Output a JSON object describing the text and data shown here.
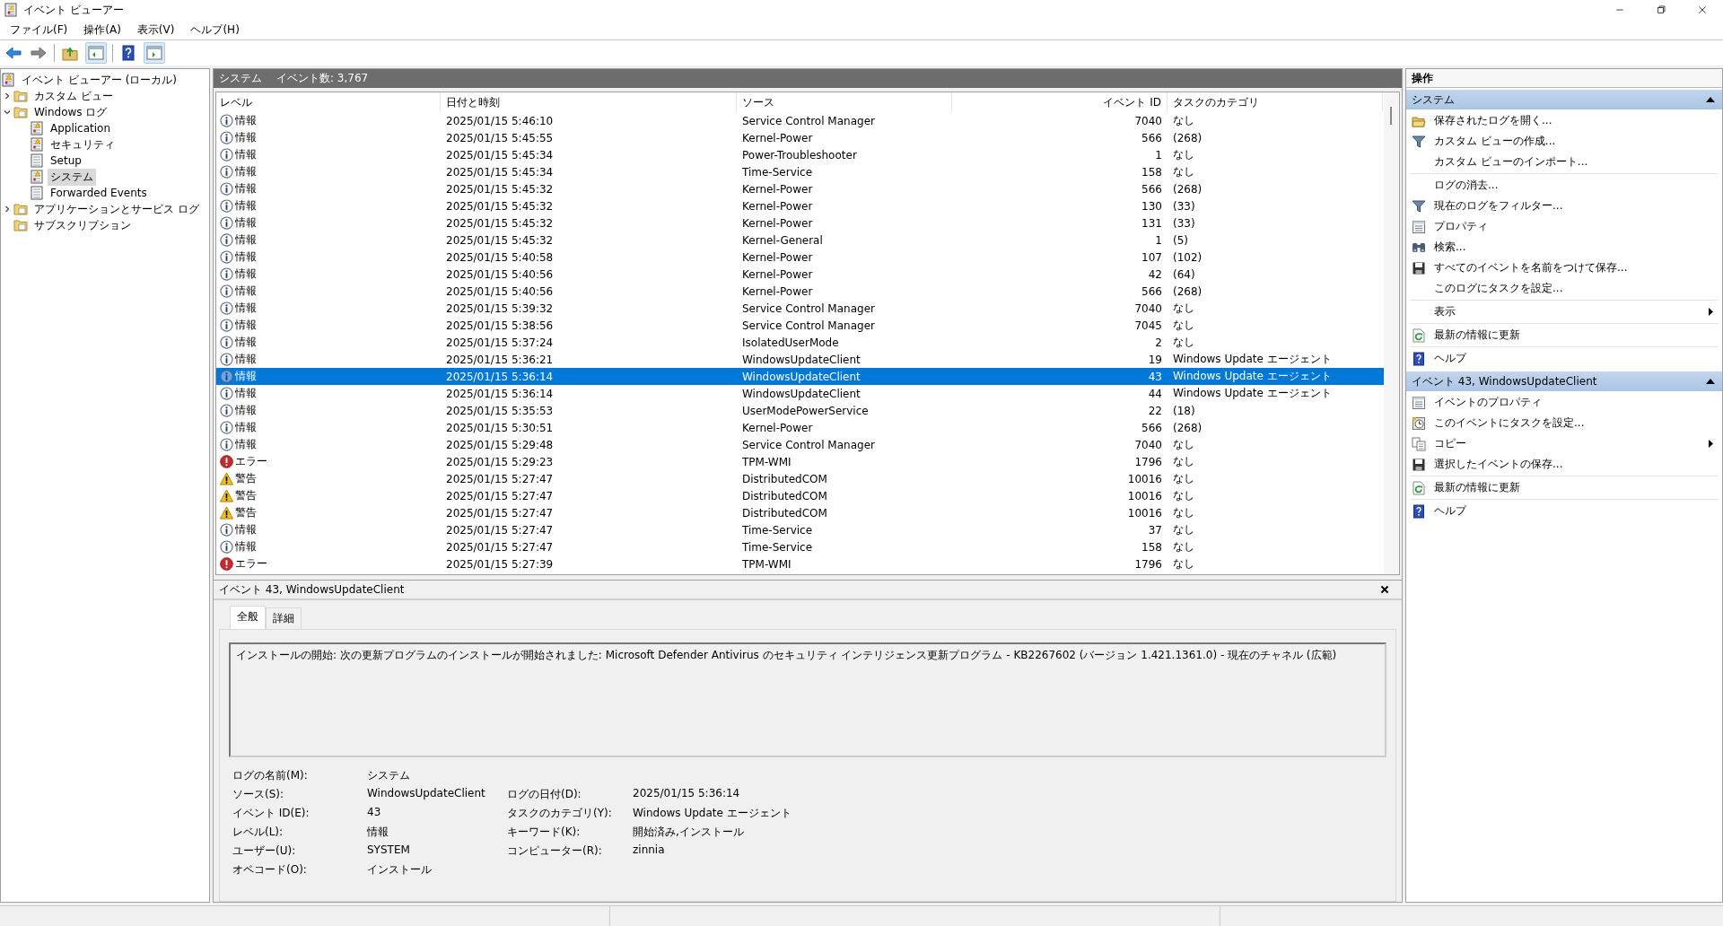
{
  "window": {
    "title": "イベント ビューアー"
  },
  "menu": [
    "ファイル(F)",
    "操作(A)",
    "表示(V)",
    "ヘルプ(H)"
  ],
  "tree": [
    {
      "label": "イベント ビューアー (ローカル)",
      "kind": "viewer",
      "selected": false,
      "children": [
        {
          "label": "カスタム ビュー",
          "kind": "folder",
          "expanded": false,
          "selected": false
        },
        {
          "label": "Windows ログ",
          "kind": "folder",
          "expanded": true,
          "selected": false,
          "children": [
            {
              "label": "Application",
              "kind": "log",
              "selected": false
            },
            {
              "label": "セキュリティ",
              "kind": "log",
              "selected": false
            },
            {
              "label": "Setup",
              "kind": "plain-log",
              "selected": false
            },
            {
              "label": "システム",
              "kind": "log",
              "selected": true
            },
            {
              "label": "Forwarded Events",
              "kind": "plain-log",
              "selected": false
            }
          ]
        },
        {
          "label": "アプリケーションとサービス ログ",
          "kind": "folder",
          "expanded": false,
          "selected": false
        },
        {
          "label": "サブスクリプション",
          "kind": "folder",
          "selected": false
        }
      ]
    }
  ],
  "log_header": {
    "title": "システム",
    "count": "イベント数: 3,767"
  },
  "table": {
    "columns": [
      "レベル",
      "日付と時刻",
      "ソース",
      "イベント ID",
      "タスクのカテゴリ"
    ],
    "rows": [
      {
        "kind": "info",
        "level": "情報",
        "date": "2025/01/15 5:46:10",
        "source": "Service Control Manager",
        "id": "7040",
        "category": "なし",
        "selected": false
      },
      {
        "kind": "info",
        "level": "情報",
        "date": "2025/01/15 5:45:55",
        "source": "Kernel-Power",
        "id": "566",
        "category": "(268)",
        "selected": false
      },
      {
        "kind": "info",
        "level": "情報",
        "date": "2025/01/15 5:45:34",
        "source": "Power-Troubleshooter",
        "id": "1",
        "category": "なし",
        "selected": false
      },
      {
        "kind": "info",
        "level": "情報",
        "date": "2025/01/15 5:45:34",
        "source": "Time-Service",
        "id": "158",
        "category": "なし",
        "selected": false
      },
      {
        "kind": "info",
        "level": "情報",
        "date": "2025/01/15 5:45:32",
        "source": "Kernel-Power",
        "id": "566",
        "category": "(268)",
        "selected": false
      },
      {
        "kind": "info",
        "level": "情報",
        "date": "2025/01/15 5:45:32",
        "source": "Kernel-Power",
        "id": "130",
        "category": "(33)",
        "selected": false
      },
      {
        "kind": "info",
        "level": "情報",
        "date": "2025/01/15 5:45:32",
        "source": "Kernel-Power",
        "id": "131",
        "category": "(33)",
        "selected": false
      },
      {
        "kind": "info",
        "level": "情報",
        "date": "2025/01/15 5:45:32",
        "source": "Kernel-General",
        "id": "1",
        "category": "(5)",
        "selected": false
      },
      {
        "kind": "info",
        "level": "情報",
        "date": "2025/01/15 5:40:58",
        "source": "Kernel-Power",
        "id": "107",
        "category": "(102)",
        "selected": false
      },
      {
        "kind": "info",
        "level": "情報",
        "date": "2025/01/15 5:40:56",
        "source": "Kernel-Power",
        "id": "42",
        "category": "(64)",
        "selected": false
      },
      {
        "kind": "info",
        "level": "情報",
        "date": "2025/01/15 5:40:56",
        "source": "Kernel-Power",
        "id": "566",
        "category": "(268)",
        "selected": false
      },
      {
        "kind": "info",
        "level": "情報",
        "date": "2025/01/15 5:39:32",
        "source": "Service Control Manager",
        "id": "7040",
        "category": "なし",
        "selected": false
      },
      {
        "kind": "info",
        "level": "情報",
        "date": "2025/01/15 5:38:56",
        "source": "Service Control Manager",
        "id": "7045",
        "category": "なし",
        "selected": false
      },
      {
        "kind": "info",
        "level": "情報",
        "date": "2025/01/15 5:37:24",
        "source": "IsolatedUserMode",
        "id": "2",
        "category": "なし",
        "selected": false
      },
      {
        "kind": "info",
        "level": "情報",
        "date": "2025/01/15 5:36:21",
        "source": "WindowsUpdateClient",
        "id": "19",
        "category": "Windows Update エージェント",
        "selected": false
      },
      {
        "kind": "info",
        "level": "情報",
        "date": "2025/01/15 5:36:14",
        "source": "WindowsUpdateClient",
        "id": "43",
        "category": "Windows Update エージェント",
        "selected": true
      },
      {
        "kind": "info",
        "level": "情報",
        "date": "2025/01/15 5:36:14",
        "source": "WindowsUpdateClient",
        "id": "44",
        "category": "Windows Update エージェント",
        "selected": false
      },
      {
        "kind": "info",
        "level": "情報",
        "date": "2025/01/15 5:35:53",
        "source": "UserModePowerService",
        "id": "22",
        "category": "(18)",
        "selected": false
      },
      {
        "kind": "info",
        "level": "情報",
        "date": "2025/01/15 5:30:51",
        "source": "Kernel-Power",
        "id": "566",
        "category": "(268)",
        "selected": false
      },
      {
        "kind": "info",
        "level": "情報",
        "date": "2025/01/15 5:29:48",
        "source": "Service Control Manager",
        "id": "7040",
        "category": "なし",
        "selected": false
      },
      {
        "kind": "error",
        "level": "エラー",
        "date": "2025/01/15 5:29:23",
        "source": "TPM-WMI",
        "id": "1796",
        "category": "なし",
        "selected": false
      },
      {
        "kind": "warning",
        "level": "警告",
        "date": "2025/01/15 5:27:47",
        "source": "DistributedCOM",
        "id": "10016",
        "category": "なし",
        "selected": false
      },
      {
        "kind": "warning",
        "level": "警告",
        "date": "2025/01/15 5:27:47",
        "source": "DistributedCOM",
        "id": "10016",
        "category": "なし",
        "selected": false
      },
      {
        "kind": "warning",
        "level": "警告",
        "date": "2025/01/15 5:27:47",
        "source": "DistributedCOM",
        "id": "10016",
        "category": "なし",
        "selected": false
      },
      {
        "kind": "info",
        "level": "情報",
        "date": "2025/01/15 5:27:47",
        "source": "Time-Service",
        "id": "37",
        "category": "なし",
        "selected": false
      },
      {
        "kind": "info",
        "level": "情報",
        "date": "2025/01/15 5:27:47",
        "source": "Time-Service",
        "id": "158",
        "category": "なし",
        "selected": false
      },
      {
        "kind": "error",
        "level": "エラー",
        "date": "2025/01/15 5:27:39",
        "source": "TPM-WMI",
        "id": "1796",
        "category": "なし",
        "selected": false
      }
    ]
  },
  "details": {
    "title": "イベント 43, WindowsUpdateClient",
    "tabs": [
      {
        "label": "全般",
        "selected": true
      },
      {
        "label": "詳細",
        "selected": false
      }
    ],
    "message": "インストールの開始: 次の更新プログラムのインストールが開始されました: Microsoft Defender Antivirus のセキュリティ インテリジェンス更新プログラム - KB2267602 (バージョン 1.421.1361.0) - 現在のチャネル (広範)",
    "fields": [
      [
        {
          "label": "ログの名前(M):",
          "value": "システム"
        }
      ],
      [
        {
          "label": "ソース(S):",
          "value": "WindowsUpdateClient"
        },
        {
          "label": "ログの日付(D):",
          "value": "2025/01/15 5:36:14"
        }
      ],
      [
        {
          "label": "イベント ID(E):",
          "value": "43"
        },
        {
          "label": "タスクのカテゴリ(Y):",
          "value": "Windows Update エージェント"
        }
      ],
      [
        {
          "label": "レベル(L):",
          "value": "情報"
        },
        {
          "label": "キーワード(K):",
          "value": "開始済み,インストール"
        }
      ],
      [
        {
          "label": "ユーザー(U):",
          "value": "SYSTEM"
        },
        {
          "label": "コンピューター(R):",
          "value": "zinnia"
        }
      ],
      [
        {
          "label": "オペコード(O):",
          "value": "インストール"
        }
      ]
    ]
  },
  "actions": {
    "title": "操作",
    "sections": [
      {
        "title": "システム",
        "expanded": true,
        "groups": [
          [
            {
              "label": "保存されたログを開く...",
              "kind": "folder"
            },
            {
              "label": "カスタム ビューの作成...",
              "kind": "filter"
            },
            {
              "label": "カスタム ビューのインポート..."
            }
          ],
          [
            {
              "label": "ログの消去..."
            },
            {
              "label": "現在のログをフィルター...",
              "kind": "filter"
            },
            {
              "label": "プロパティ",
              "kind": "properties"
            },
            {
              "label": "検索...",
              "kind": "binoculars"
            },
            {
              "label": "すべてのイベントを名前をつけて保存...",
              "kind": "save"
            },
            {
              "label": "このログにタスクを設定..."
            }
          ],
          [
            {
              "label": "表示",
              "submenu": true
            }
          ],
          [
            {
              "label": "最新の情報に更新",
              "kind": "refresh"
            }
          ],
          [
            {
              "label": "ヘルプ",
              "kind": "help"
            }
          ]
        ]
      },
      {
        "title": "イベント 43, WindowsUpdateClient",
        "expanded": true,
        "groups": [
          [
            {
              "label": "イベントのプロパティ",
              "kind": "properties"
            },
            {
              "label": "このイベントにタスクを設定...",
              "kind": "clock"
            },
            {
              "label": "コピー",
              "kind": "copy",
              "submenu": true
            },
            {
              "label": "選択したイベントの保存...",
              "kind": "save"
            }
          ],
          [
            {
              "label": "最新の情報に更新",
              "kind": "refresh"
            }
          ],
          [
            {
              "label": "ヘルプ",
              "kind": "help"
            }
          ]
        ]
      }
    ]
  }
}
